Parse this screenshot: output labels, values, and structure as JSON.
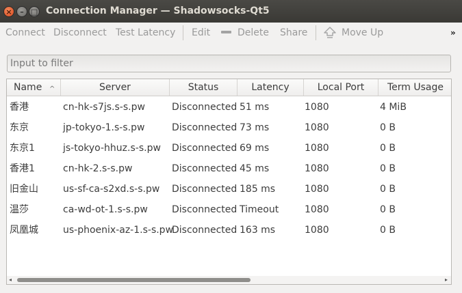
{
  "window": {
    "title": "Connection Manager — Shadowsocks-Qt5",
    "close_glyph": "×",
    "minimize_glyph": "–",
    "maximize_glyph": "□"
  },
  "toolbar": {
    "connect": "Connect",
    "disconnect": "Disconnect",
    "test_latency": "Test Latency",
    "edit": "Edit",
    "delete": "Delete",
    "share": "Share",
    "move_up": "Move Up",
    "overflow": "»",
    "delete_icon": "minus-icon",
    "move_up_icon": "move-up-icon"
  },
  "filter": {
    "placeholder": "Input to filter",
    "value": ""
  },
  "table": {
    "columns": [
      "Name",
      "Server",
      "Status",
      "Latency",
      "Local Port",
      "Term Usage"
    ],
    "sorted_column": "Name",
    "sort_glyph": "^",
    "rows": [
      [
        "香港",
        "cn-hk-s7js.s-s.pw",
        "Disconnected",
        "51 ms",
        "1080",
        "4 MiB"
      ],
      [
        "东京",
        "jp-tokyo-1.s-s.pw",
        "Disconnected",
        "73 ms",
        "1080",
        "0 B"
      ],
      [
        "东京1",
        "js-tokyo-hhuz.s-s.pw",
        "Disconnected",
        "69 ms",
        "1080",
        "0 B"
      ],
      [
        "香港1",
        "cn-hk-2.s-s.pw",
        "Disconnected",
        "45 ms",
        "1080",
        "0 B"
      ],
      [
        "旧金山",
        "us-sf-ca-s2xd.s-s.pw",
        "Disconnected",
        "185 ms",
        "1080",
        "0 B"
      ],
      [
        "温莎",
        "ca-wd-ot-1.s-s.pw",
        "Disconnected",
        "Timeout",
        "1080",
        "0 B"
      ],
      [
        "凤凰城",
        "us-phoenix-az-1.s-s.pw",
        "Disconnected",
        "163 ms",
        "1080",
        "0 B"
      ]
    ]
  },
  "scrollbar": {
    "left_arrow": "◂",
    "right_arrow": "▸"
  }
}
